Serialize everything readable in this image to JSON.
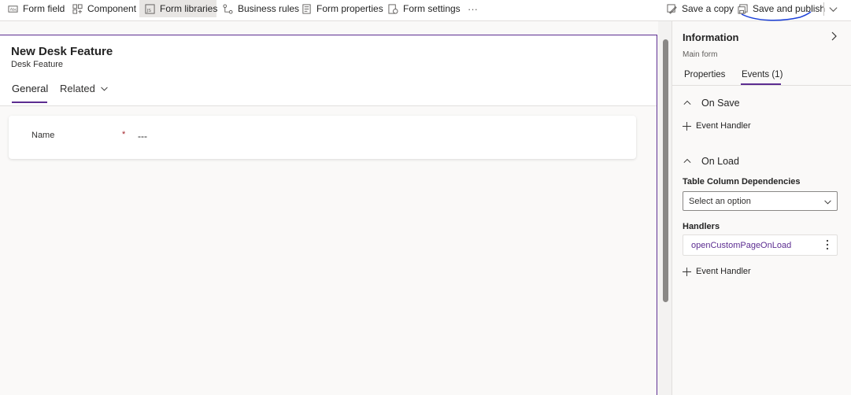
{
  "toolbar": {
    "form_field": "Form field",
    "component": "Component",
    "form_libraries": "Form libraries",
    "business_rules": "Business rules",
    "form_properties": "Form properties",
    "form_settings": "Form settings",
    "more": "···",
    "save_copy": "Save a copy",
    "save_publish": "Save and publish",
    "accent_color": "#5c2d91"
  },
  "form": {
    "title": "New Desk Feature",
    "subtitle": "Desk Feature",
    "tabs": [
      {
        "label": "General",
        "selected": true
      },
      {
        "label": "Related",
        "selected": false
      }
    ],
    "fields": [
      {
        "label": "Name",
        "required_marker": "*",
        "value": "---"
      }
    ]
  },
  "panel": {
    "title": "Information",
    "subtitle": "Main form",
    "tabs": [
      {
        "label": "Properties",
        "selected": false
      },
      {
        "label": "Events (1)",
        "selected": true
      }
    ],
    "on_save": {
      "heading": "On Save",
      "add_handler": "Event Handler"
    },
    "on_load": {
      "heading": "On Load",
      "dependencies_label": "Table Column Dependencies",
      "dropdown_placeholder": "Select an option",
      "handlers_label": "Handlers",
      "handlers": [
        "openCustomPageOnLoad"
      ],
      "add_handler": "Event Handler"
    }
  }
}
